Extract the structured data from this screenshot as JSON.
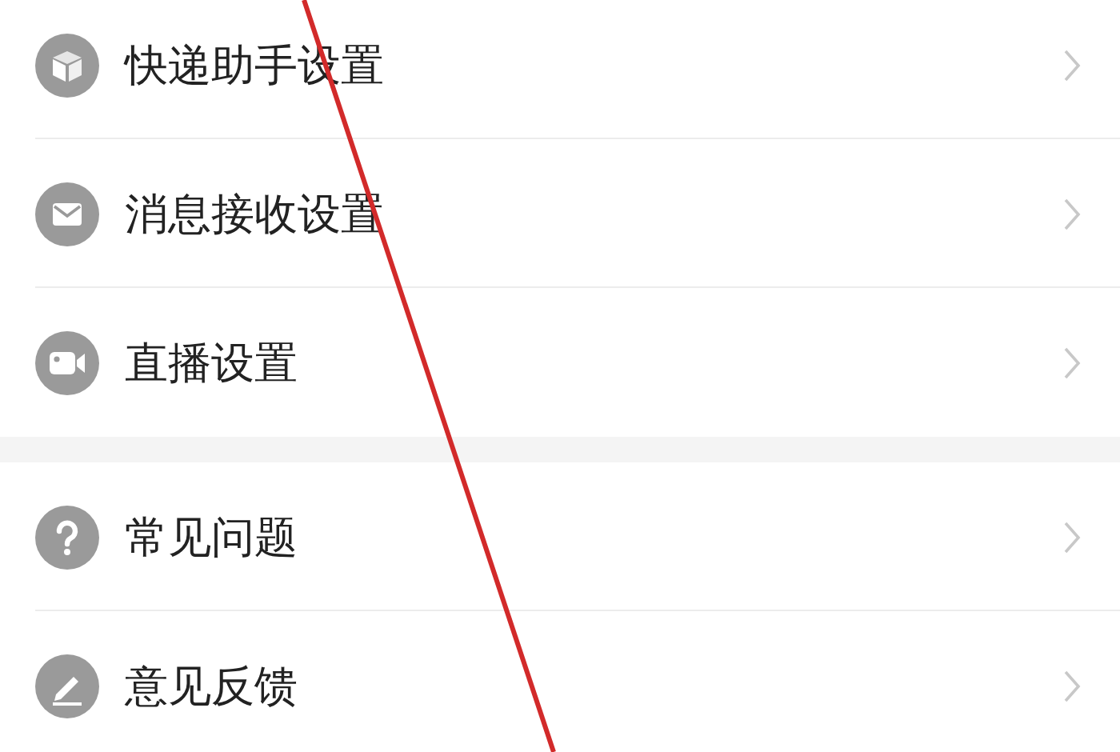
{
  "sections": [
    {
      "items": [
        {
          "kind": "box",
          "label": "快递助手设置"
        },
        {
          "kind": "mail",
          "label": "消息接收设置"
        },
        {
          "kind": "video",
          "label": "直播设置"
        }
      ]
    },
    {
      "items": [
        {
          "kind": "question",
          "label": "常见问题"
        },
        {
          "kind": "pencil",
          "label": "意见反馈"
        }
      ]
    }
  ]
}
